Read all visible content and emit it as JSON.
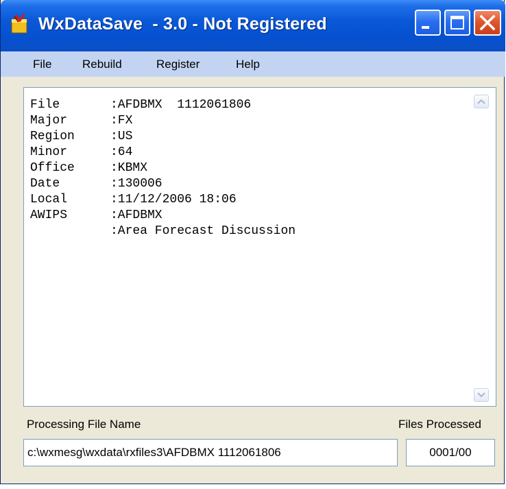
{
  "window": {
    "title": "WxDataSave  - 3.0 - Not Registered",
    "controls": {
      "minimize": "minimize-icon",
      "maximize": "maximize-icon",
      "close": "close-icon"
    },
    "colors": {
      "titlebar": "#0551d0",
      "menubar": "#c3d4f3",
      "face": "#ece9d8",
      "close": "#e0562c"
    }
  },
  "menu": {
    "items": [
      {
        "label": "File"
      },
      {
        "label": "Rebuild"
      },
      {
        "label": "Register"
      },
      {
        "label": "Help"
      }
    ]
  },
  "details": {
    "rows": [
      {
        "key": "File",
        "value": ":AFDBMX  1112061806"
      },
      {
        "key": "Major",
        "value": ":FX"
      },
      {
        "key": "Region",
        "value": ":US"
      },
      {
        "key": "Minor",
        "value": ":64"
      },
      {
        "key": "Office",
        "value": ":KBMX"
      },
      {
        "key": "Date",
        "value": ":130006"
      },
      {
        "key": "Local",
        "value": ":11/12/2006 18:06"
      },
      {
        "key": "AWIPS",
        "value": ":AFDBMX"
      },
      {
        "key": "",
        "value": ":Area Forecast Discussion"
      }
    ]
  },
  "processing": {
    "file_label": "Processing File Name",
    "file_value": "c:\\wxmesg\\wxdata\\rxfiles3\\AFDBMX 1112061806",
    "count_label": "Files Processed",
    "count_value": "0001/00"
  }
}
